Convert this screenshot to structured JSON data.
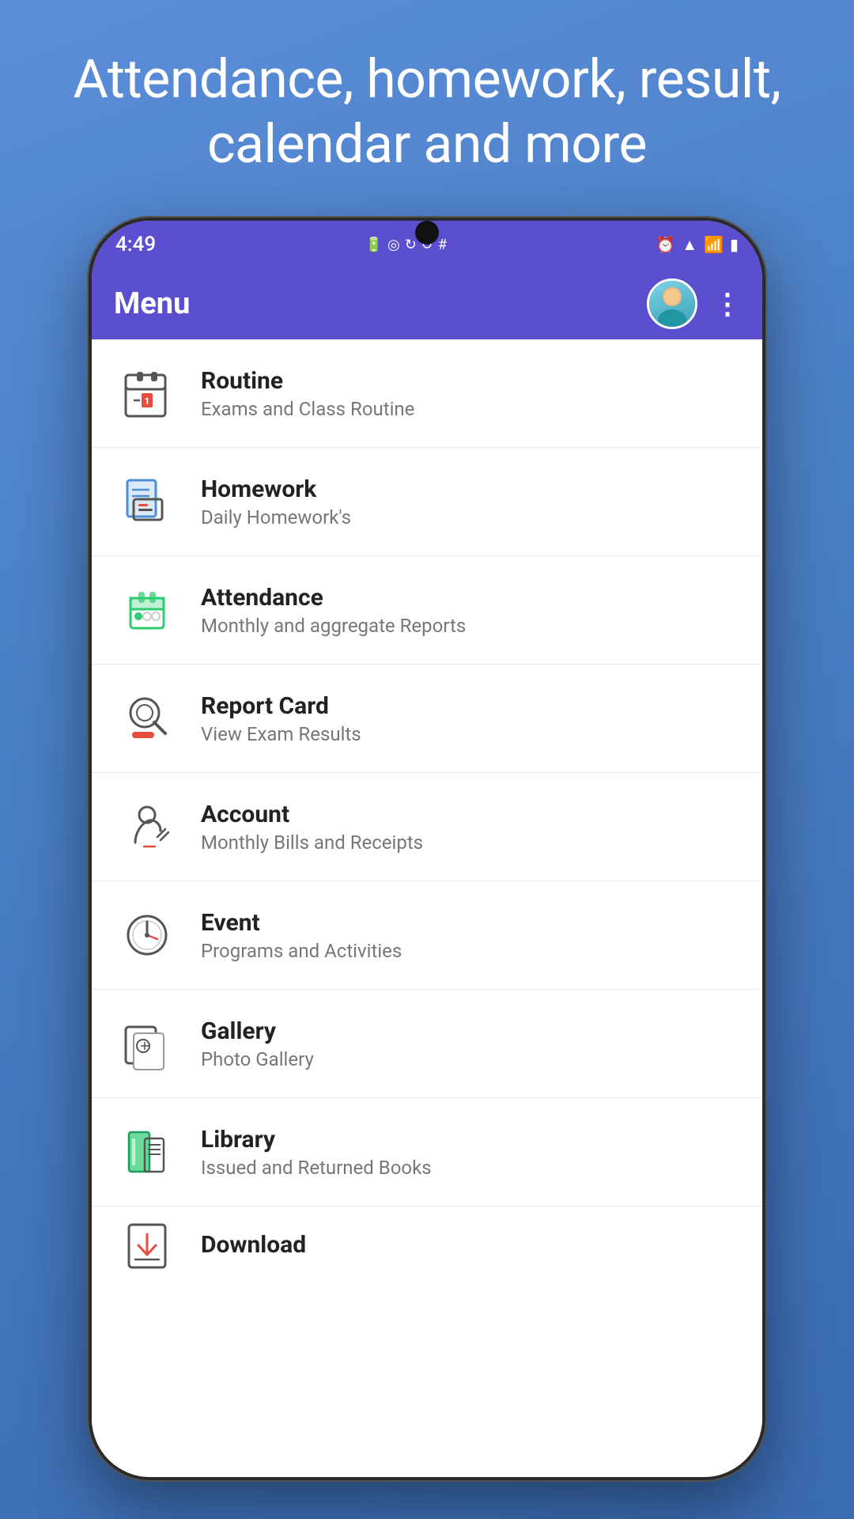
{
  "headline": "Attendance, homework, result, calendar and more",
  "colors": {
    "background_start": "#5b8dd9",
    "background_end": "#3a6ab0",
    "header_bg": "#5b4fcf",
    "white": "#ffffff",
    "text_dark": "#222222",
    "text_muted": "#777777",
    "divider": "#e8eaf0"
  },
  "status_bar": {
    "time": "4:49",
    "right_icons": [
      "alarm",
      "wifi",
      "signal",
      "battery"
    ]
  },
  "app_header": {
    "title": "Menu",
    "more_button_label": "⋮"
  },
  "menu_items": [
    {
      "id": "routine",
      "title": "Routine",
      "subtitle": "Exams and Class Routine",
      "icon": "routine"
    },
    {
      "id": "homework",
      "title": "Homework",
      "subtitle": "Daily Homework's",
      "icon": "homework"
    },
    {
      "id": "attendance",
      "title": "Attendance",
      "subtitle": "Monthly and aggregate Reports",
      "icon": "attendance"
    },
    {
      "id": "report-card",
      "title": "Report Card",
      "subtitle": "View Exam Results",
      "icon": "report-card"
    },
    {
      "id": "account",
      "title": "Account",
      "subtitle": "Monthly Bills and Receipts",
      "icon": "account"
    },
    {
      "id": "event",
      "title": "Event",
      "subtitle": "Programs and Activities",
      "icon": "event"
    },
    {
      "id": "gallery",
      "title": "Gallery",
      "subtitle": "Photo Gallery",
      "icon": "gallery"
    },
    {
      "id": "library",
      "title": "Library",
      "subtitle": "Issued and Returned Books",
      "icon": "library"
    },
    {
      "id": "download",
      "title": "Download",
      "subtitle": "",
      "icon": "download"
    }
  ]
}
